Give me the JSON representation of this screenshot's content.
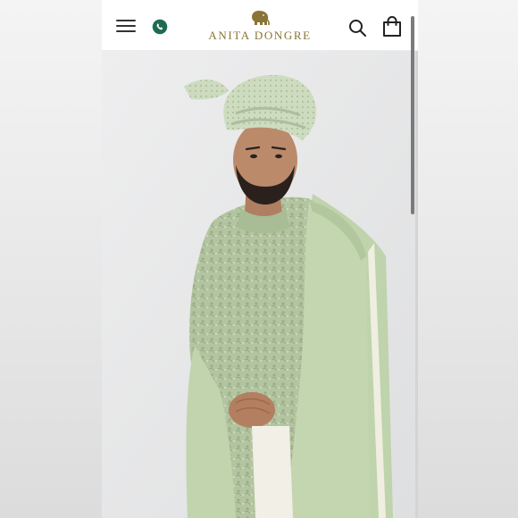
{
  "brand": {
    "name": "ANITA DONGRE",
    "accent_color": "#8a7436"
  },
  "header": {
    "menu_icon": "hamburger-menu-icon",
    "whatsapp_icon": "whatsapp-icon",
    "search_icon": "search-icon",
    "bag_icon": "shopping-bag-icon"
  },
  "hero": {
    "image": "product-photo",
    "palette": {
      "background": "#e9e9ea",
      "fabric": "#b9cda6",
      "fabric_dark": "#8fa77d",
      "skin": "#b88668",
      "hair": "#2a211c"
    }
  }
}
